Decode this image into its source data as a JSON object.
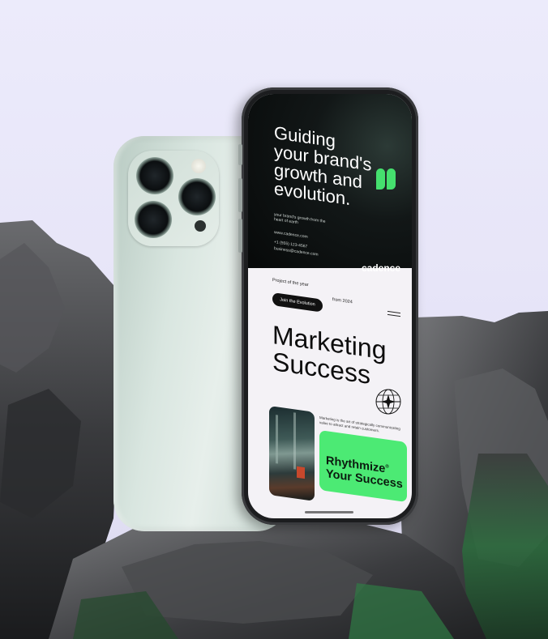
{
  "hero": {
    "headline_lines": [
      "Guiding",
      "your brand's",
      "growth and",
      "evolution."
    ],
    "tagline": "your brand's growth from the heart of earth",
    "website": "www.cadence.com",
    "phone": "+1 (555) 123-4567",
    "email": "business@cadence.com"
  },
  "brand": {
    "name": "cadence"
  },
  "content": {
    "project_label": "Project of the year",
    "from_label": "from 2024",
    "join_button": "Join the Evolution",
    "title_lines": [
      "Marketing",
      "Success"
    ],
    "description": "Marketing is the art of strategically communicating value to attract and retain customers.",
    "card_lines": [
      "Rhythmize",
      "Your Success"
    ],
    "card_mark": "®"
  },
  "colors": {
    "background": "#ecebfb",
    "accent_green": "#4cea74",
    "phone_back": "#d9e6e0",
    "hero_dark": "#0b0f0f",
    "rock": "#3a3b3d"
  },
  "icons": [
    "globe-icon",
    "menu-icon",
    "cadence-logo-icon"
  ]
}
